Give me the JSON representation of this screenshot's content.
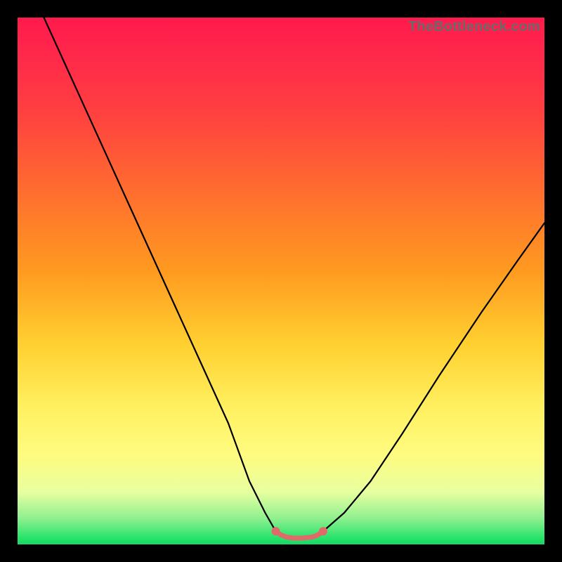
{
  "watermark": "TheBottleneck.com",
  "chart_data": {
    "type": "line",
    "title": "",
    "xlabel": "",
    "ylabel": "",
    "xlim": [
      0,
      100
    ],
    "ylim": [
      0,
      100
    ],
    "grid": false,
    "legend": false,
    "series": [
      {
        "name": "main-curve",
        "color": "#000000",
        "x": [
          5,
          10,
          15,
          20,
          25,
          30,
          35,
          40,
          44,
          47,
          49,
          51,
          54,
          56,
          58,
          62,
          67,
          73,
          80,
          88,
          95,
          100
        ],
        "y": [
          100,
          89,
          78,
          67,
          56,
          45,
          34,
          23,
          12,
          6,
          2.5,
          1.4,
          1.2,
          1.4,
          2.5,
          6,
          12,
          21,
          32,
          44,
          54,
          61
        ]
      },
      {
        "name": "highlight-segment",
        "color": "#e06a6a",
        "x": [
          49,
          50,
          51,
          52.5,
          54,
          55,
          56,
          57,
          58
        ],
        "y": [
          2.5,
          1.8,
          1.4,
          1.2,
          1.2,
          1.3,
          1.4,
          1.8,
          2.5
        ]
      }
    ],
    "highlight_dots": {
      "color": "#e06a6a",
      "points": [
        {
          "x": 49,
          "y": 2.5
        },
        {
          "x": 58,
          "y": 2.5
        }
      ]
    }
  }
}
